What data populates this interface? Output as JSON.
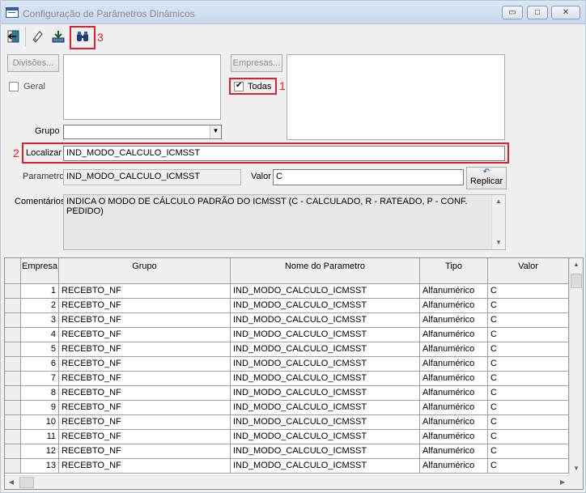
{
  "window": {
    "title": "Configuração de Parâmetros Dinâmicos",
    "minimize_glyph": "▭",
    "maximize_glyph": "□",
    "close_glyph": "✕"
  },
  "toolbar": {
    "buttons": [
      {
        "icon": "exit-door-icon"
      },
      {
        "icon": "eraser-icon"
      },
      {
        "icon": "save-download-icon"
      },
      {
        "icon": "binoculars-icon"
      }
    ]
  },
  "annotations": {
    "label_1": "1",
    "label_2": "2",
    "label_3": "3",
    "color": "#e0202a"
  },
  "filters": {
    "divisoes_button": "Divisões...",
    "geral_label": "Geral",
    "geral_checked": false,
    "empresas_button": "Empresas...",
    "todas_label": "Todas",
    "todas_checked": true,
    "grupo_label": "Grupo",
    "grupo_value": "",
    "localizar_label": "Localizar",
    "localizar_value": "IND_MODO_CALCULO_ICMSST",
    "parametro_label": "Parametro",
    "parametro_value": "IND_MODO_CALCULO_ICMSST",
    "valor_label": "Valor",
    "valor_value": "C",
    "replicar_button": "Replicar",
    "comentarios_label": "Comentários",
    "comentarios_value": "INDICA O MODO DE CÁLCULO PADRÃO DO ICMSST (C - CALCULADO, R - RATEADO, P - CONF. PEDIDO)"
  },
  "grid": {
    "columns": [
      "Empresa",
      "Grupo",
      "Nome do Parametro",
      "Tipo",
      "Valor"
    ],
    "rows": [
      [
        "1",
        "RECEBTO_NF",
        "IND_MODO_CALCULO_ICMSST",
        "Alfanumérico",
        "C"
      ],
      [
        "2",
        "RECEBTO_NF",
        "IND_MODO_CALCULO_ICMSST",
        "Alfanumérico",
        "C"
      ],
      [
        "3",
        "RECEBTO_NF",
        "IND_MODO_CALCULO_ICMSST",
        "Alfanumérico",
        "C"
      ],
      [
        "4",
        "RECEBTO_NF",
        "IND_MODO_CALCULO_ICMSST",
        "Alfanumérico",
        "C"
      ],
      [
        "5",
        "RECEBTO_NF",
        "IND_MODO_CALCULO_ICMSST",
        "Alfanumérico",
        "C"
      ],
      [
        "6",
        "RECEBTO_NF",
        "IND_MODO_CALCULO_ICMSST",
        "Alfanumérico",
        "C"
      ],
      [
        "7",
        "RECEBTO_NF",
        "IND_MODO_CALCULO_ICMSST",
        "Alfanumérico",
        "C"
      ],
      [
        "8",
        "RECEBTO_NF",
        "IND_MODO_CALCULO_ICMSST",
        "Alfanumérico",
        "C"
      ],
      [
        "9",
        "RECEBTO_NF",
        "IND_MODO_CALCULO_ICMSST",
        "Alfanumérico",
        "C"
      ],
      [
        "10",
        "RECEBTO_NF",
        "IND_MODO_CALCULO_ICMSST",
        "Alfanumérico",
        "C"
      ],
      [
        "11",
        "RECEBTO_NF",
        "IND_MODO_CALCULO_ICMSST",
        "Alfanumérico",
        "C"
      ],
      [
        "12",
        "RECEBTO_NF",
        "IND_MODO_CALCULO_ICMSST",
        "Alfanumérico",
        "C"
      ],
      [
        "13",
        "RECEBTO_NF",
        "IND_MODO_CALCULO_ICMSST",
        "Alfanumérico",
        "C"
      ]
    ]
  }
}
